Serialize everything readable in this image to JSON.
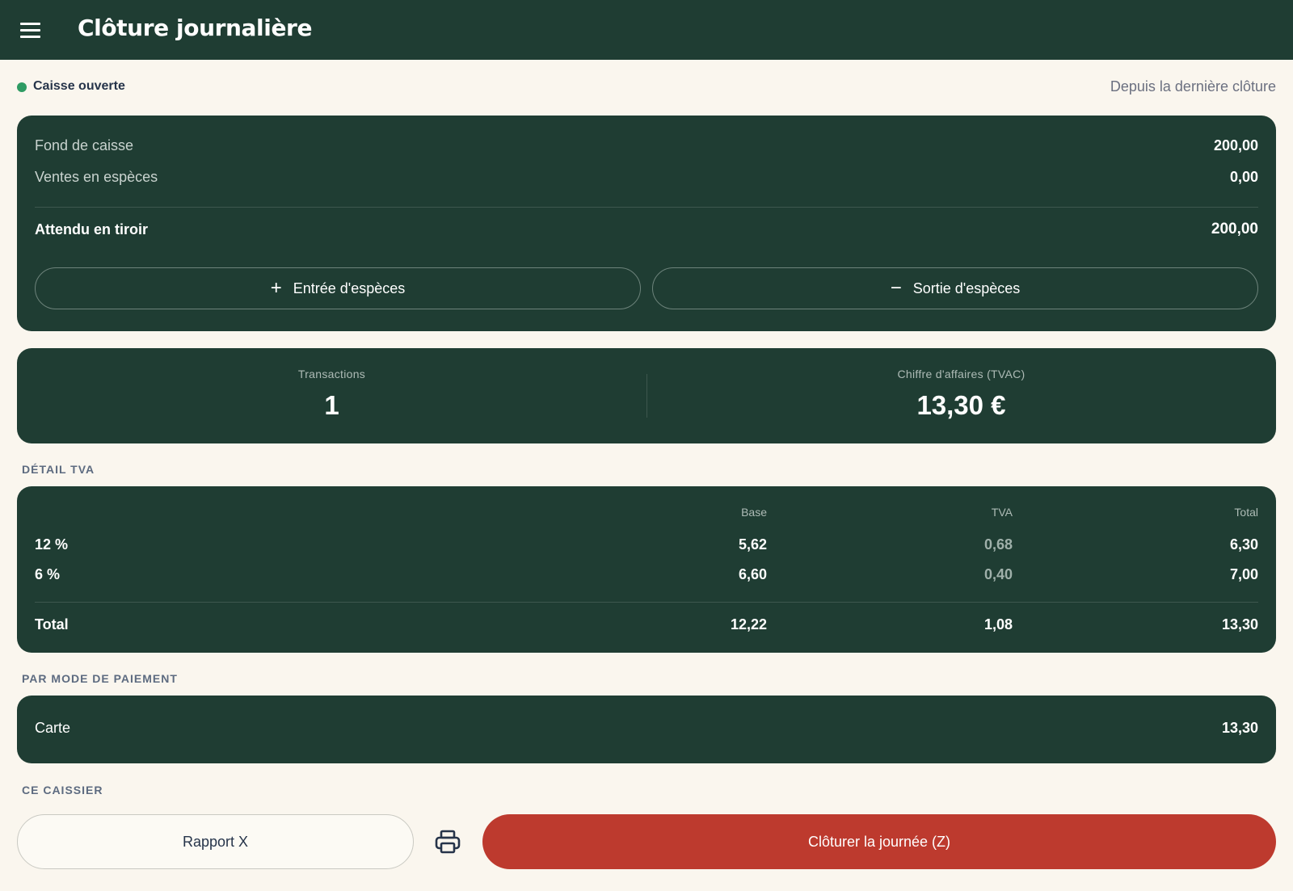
{
  "header": {
    "title": "Clôture journalière",
    "menu_icon": "menu-icon"
  },
  "status": {
    "label": "Caisse ouverte",
    "color": "#2e9b63",
    "period": "Depuis la dernière clôture"
  },
  "cash": {
    "rows": [
      {
        "label": "Fond de caisse",
        "value": "200,00"
      },
      {
        "label": "Ventes en espèces",
        "value": "0,00"
      }
    ],
    "expected": {
      "label": "Attendu en tiroir",
      "value": "200,00"
    },
    "buttons": {
      "cash_in": {
        "icon": "plus-icon",
        "glyph": "+",
        "label": "Entrée d'espèces"
      },
      "cash_out": {
        "icon": "minus-icon",
        "glyph": "−",
        "label": "Sortie d'espèces"
      }
    }
  },
  "stats": {
    "transactions": {
      "label": "Transactions",
      "value": "1"
    },
    "revenue": {
      "label": "Chiffre d'affaires (TVAC)",
      "value": "13,30 €"
    }
  },
  "vat": {
    "title": "DÉTAIL TVA",
    "columns": [
      "",
      "Base",
      "TVA",
      "Total"
    ],
    "rows": [
      {
        "rate": "12 %",
        "base": "5,62",
        "tva": "0,68",
        "total": "6,30"
      },
      {
        "rate": "6 %",
        "base": "6,60",
        "tva": "0,40",
        "total": "7,00"
      }
    ],
    "total": {
      "rate": "Total",
      "base": "12,22",
      "tva": "1,08",
      "total": "13,30"
    }
  },
  "payment": {
    "title": "PAR MODE DE PAIEMENT",
    "rows": [
      {
        "label": "Carte",
        "value": "13,30"
      }
    ]
  },
  "cashier": {
    "title": "CE CAISSIER"
  },
  "actions": {
    "report_x": "Rapport X",
    "print_icon": "printer-icon",
    "close_z": "Clôturer la journée (Z)",
    "close_color": "#bd3a2e"
  },
  "colors": {
    "card": "#1f3d33",
    "background": "#faf6ee",
    "accent": "#bd3a2e"
  }
}
